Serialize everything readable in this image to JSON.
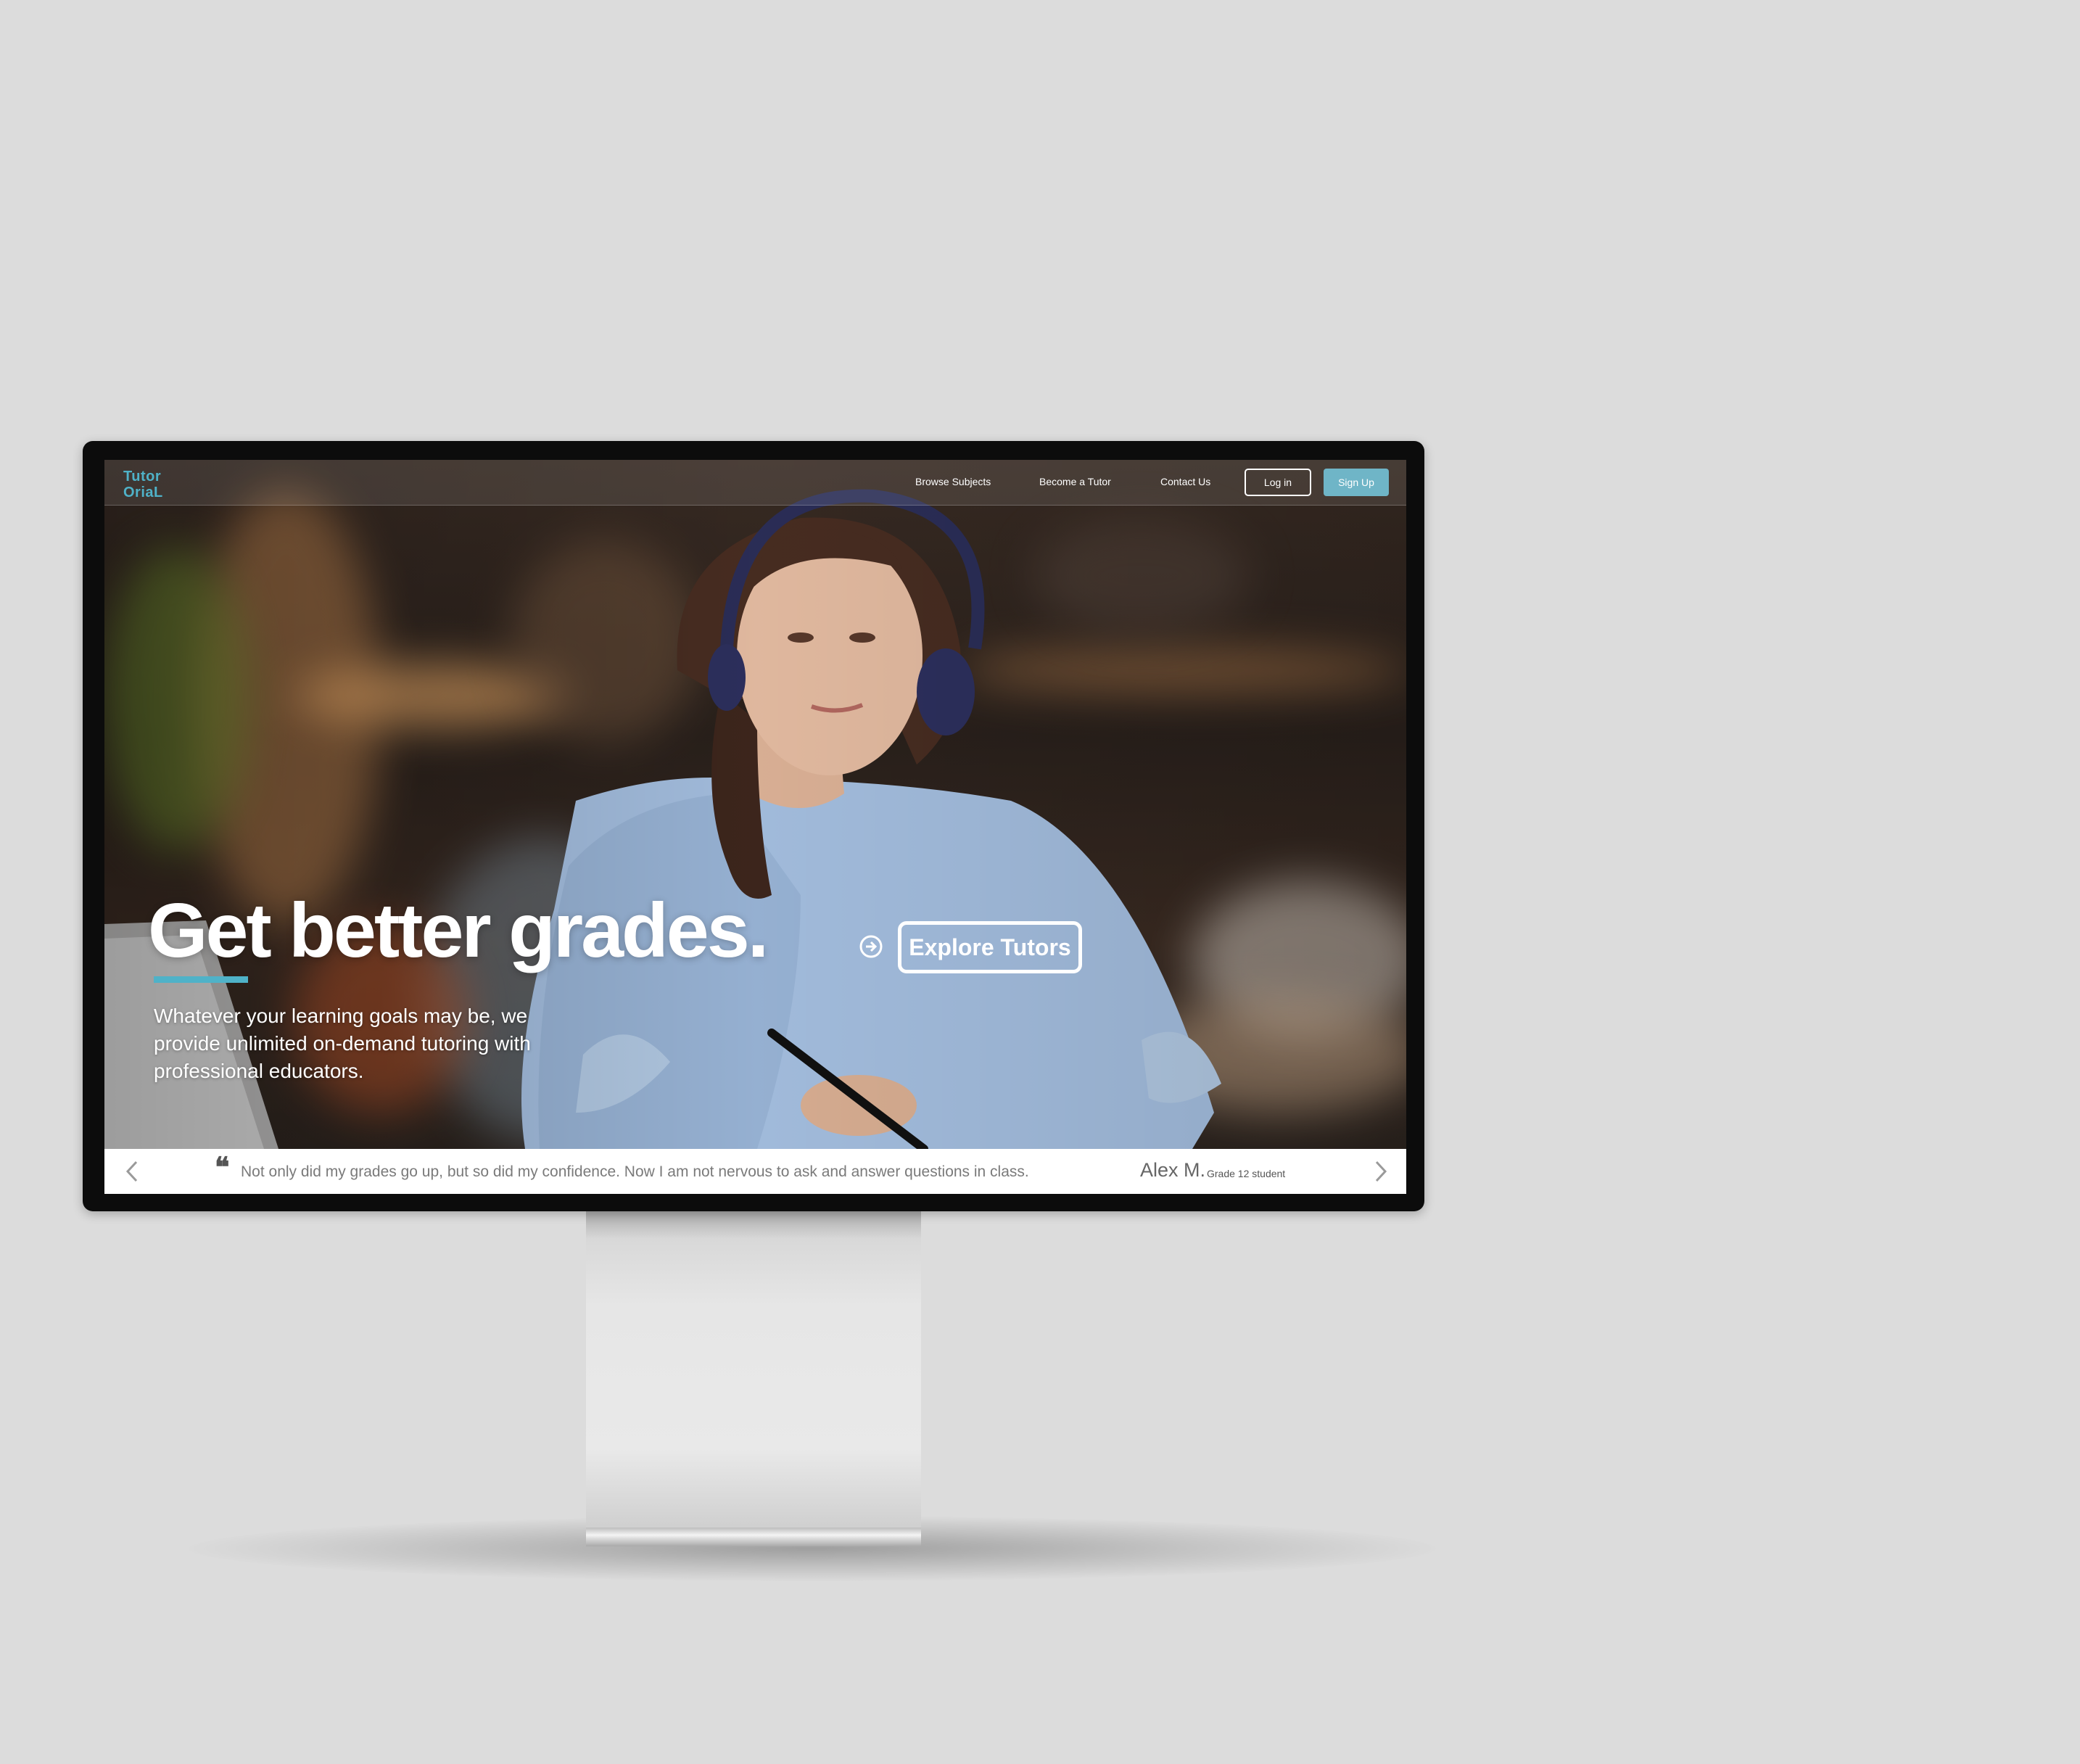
{
  "brand": {
    "logo_line1": "Tutor",
    "logo_line2": "OriaL",
    "accent": "#4fb2c8"
  },
  "nav": {
    "links": [
      "Browse Subjects",
      "Become a Tutor",
      "Contact Us"
    ],
    "login_label": "Log in",
    "signup_label": "Sign Up"
  },
  "hero": {
    "headline": "Get better grades.",
    "cta_label": "Explore Tutors",
    "cta_icon": "arrow-right-circle-icon",
    "description": "Whatever your learning goals may be, we provide unlimited on-demand tutoring with professional educators."
  },
  "testimonial": {
    "quote_mark": "❝",
    "quote": "Not only did my grades go up, but so did my confidence. Now I am not nervous to ask and answer questions in class.",
    "author": "Alex M.",
    "role": "Grade 12 student",
    "prev_icon": "chevron-left-icon",
    "next_icon": "chevron-right-icon"
  }
}
